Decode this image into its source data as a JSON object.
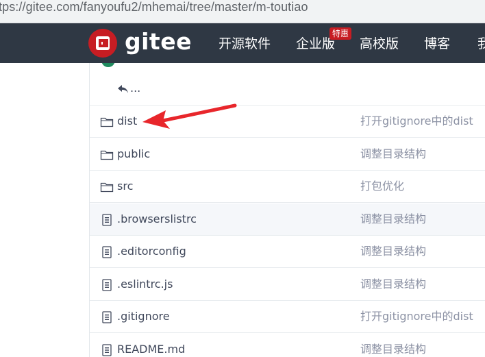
{
  "browser": {
    "url": "tps://gitee.com/fanyoufu2/mhemai/tree/master/m-toutiao"
  },
  "navbar": {
    "logo_text": "gitee",
    "items": [
      {
        "label": "开源软件"
      },
      {
        "label": "企业版"
      },
      {
        "label": "高校版"
      },
      {
        "label": "博客"
      },
      {
        "label": "我"
      }
    ],
    "badge": "特惠",
    "bg_color": "#2f3844",
    "brand_color": "#c71d23"
  },
  "file_list": {
    "back_label": "...",
    "rows": [
      {
        "type": "folder",
        "name": "dist",
        "message": "打开gitignore中的dist",
        "highlighted": false
      },
      {
        "type": "folder",
        "name": "public",
        "message": "调整目录结构",
        "highlighted": false
      },
      {
        "type": "folder",
        "name": "src",
        "message": "打包优化",
        "highlighted": false
      },
      {
        "type": "file",
        "name": ".browserslistrc",
        "message": "调整目录结构",
        "highlighted": true
      },
      {
        "type": "file",
        "name": ".editorconfig",
        "message": "调整目录结构",
        "highlighted": false
      },
      {
        "type": "file",
        "name": ".eslintrc.js",
        "message": "调整目录结构",
        "highlighted": false
      },
      {
        "type": "file",
        "name": ".gitignore",
        "message": "打开gitignore中的dist",
        "highlighted": false
      },
      {
        "type": "file",
        "name": "README.md",
        "message": "调整目录结构",
        "highlighted": false
      }
    ]
  },
  "annotation": {
    "arrow_color": "#e8262b"
  }
}
